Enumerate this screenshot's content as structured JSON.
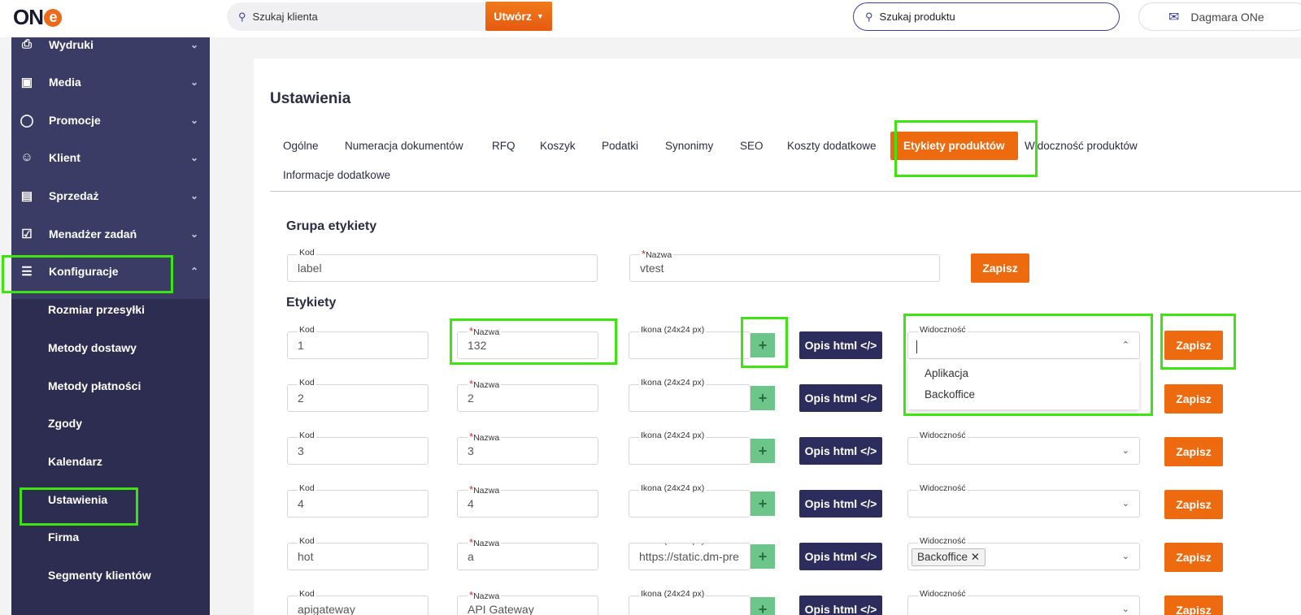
{
  "logo": {
    "text": "ON",
    "e": "e"
  },
  "header": {
    "client_search_placeholder": "Szukaj klienta",
    "create_label": "Utwórz",
    "product_search_placeholder": "Szukaj produktu",
    "user_name": "Dagmara ONe"
  },
  "sidebar": {
    "items": [
      {
        "label": "Wydruki",
        "icon": "printer-icon"
      },
      {
        "label": "Media",
        "icon": "image-icon"
      },
      {
        "label": "Promocje",
        "icon": "award-icon"
      },
      {
        "label": "Klient",
        "icon": "users-icon"
      },
      {
        "label": "Sprzedaż",
        "icon": "basket-icon"
      },
      {
        "label": "Menadżer zadań",
        "icon": "checklist-icon"
      },
      {
        "label": "Konfiguracje",
        "icon": "sliders-icon"
      }
    ],
    "subitems": [
      "Rozmiar przesyłki",
      "Metody dostawy",
      "Metody płatności",
      "Zgody",
      "Kalendarz",
      "Ustawienia",
      "Firma",
      "Segmenty klientów"
    ]
  },
  "page": {
    "title": "Ustawienia"
  },
  "tabs": [
    "Ogólne",
    "Numeracja dokumentów",
    "RFQ",
    "Koszyk",
    "Podatki",
    "Synonimy",
    "SEO",
    "Koszty dodatkowe",
    "Etykiety produktów",
    "Widoczność produktów",
    "Informacje dodatkowe"
  ],
  "group": {
    "section_title": "Grupa etykiety",
    "kod_label": "Kod",
    "kod_value": "label",
    "nazwa_label": "Nazwa",
    "nazwa_value": "vtest",
    "save_label": "Zapisz"
  },
  "labels": {
    "section_title": "Etykiety",
    "kod_label": "Kod",
    "nazwa_label": "Nazwa",
    "ikona_label": "Ikona (24x24 px)",
    "opis_label": "Opis html </>",
    "widocznosc_label": "Widoczność",
    "save_label": "Zapisz",
    "plus": "+",
    "rows": [
      {
        "kod": "1",
        "nazwa": "132",
        "ikona": "",
        "tag": ""
      },
      {
        "kod": "2",
        "nazwa": "2",
        "ikona": "",
        "tag": ""
      },
      {
        "kod": "3",
        "nazwa": "3",
        "ikona": "",
        "tag": ""
      },
      {
        "kod": "4",
        "nazwa": "4",
        "ikona": "",
        "tag": ""
      },
      {
        "kod": "hot",
        "nazwa": "a",
        "ikona": "https://static.dm-pre",
        "tag": "Backoffice ✕"
      },
      {
        "kod": "apigateway",
        "nazwa": "API Gateway",
        "ikona": "",
        "tag": ""
      }
    ],
    "dropdown_options": [
      "Aplikacja",
      "Backoffice"
    ]
  }
}
